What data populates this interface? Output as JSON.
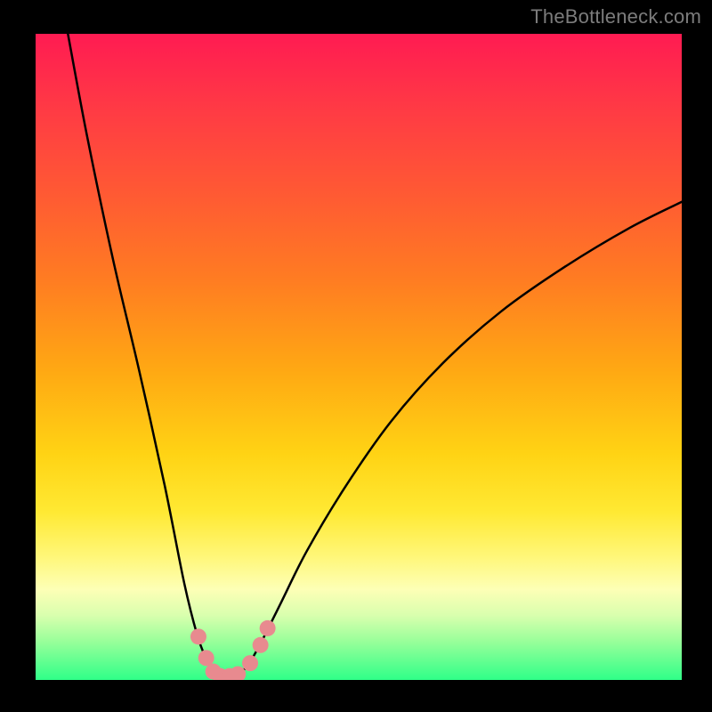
{
  "watermark": "TheBottleneck.com",
  "colors": {
    "gradient_top": "#ff1b52",
    "gradient_bottom": "#2fff88",
    "curve": "#000000",
    "marker": "#e88a8f",
    "frame": "#000000"
  },
  "chart_data": {
    "type": "line",
    "title": "",
    "xlabel": "",
    "ylabel": "",
    "xlim": [
      0,
      100
    ],
    "ylim": [
      0,
      100
    ],
    "grid": false,
    "legend": false,
    "series": [
      {
        "name": "bottleneck-curve",
        "x": [
          5,
          8,
          12,
          16,
          20,
          23,
          25,
          26.5,
          27.5,
          28.5,
          30,
          31.5,
          33,
          35,
          38,
          42,
          48,
          55,
          63,
          72,
          82,
          92,
          100
        ],
        "y": [
          100,
          84,
          65,
          48,
          30,
          15,
          7,
          3,
          1,
          0.5,
          0.5,
          1,
          2.5,
          6,
          12,
          20,
          30,
          40,
          49,
          57,
          64,
          70,
          74
        ]
      }
    ],
    "markers": {
      "name": "bottleneck-zone",
      "points": [
        {
          "x": 25.2,
          "y": 6.7
        },
        {
          "x": 26.4,
          "y": 3.4
        },
        {
          "x": 27.5,
          "y": 1.3
        },
        {
          "x": 28.6,
          "y": 0.6
        },
        {
          "x": 30.0,
          "y": 0.6
        },
        {
          "x": 31.3,
          "y": 0.9
        },
        {
          "x": 33.2,
          "y": 2.6
        },
        {
          "x": 34.8,
          "y": 5.4
        },
        {
          "x": 35.9,
          "y": 8.0
        }
      ]
    },
    "annotations": []
  }
}
